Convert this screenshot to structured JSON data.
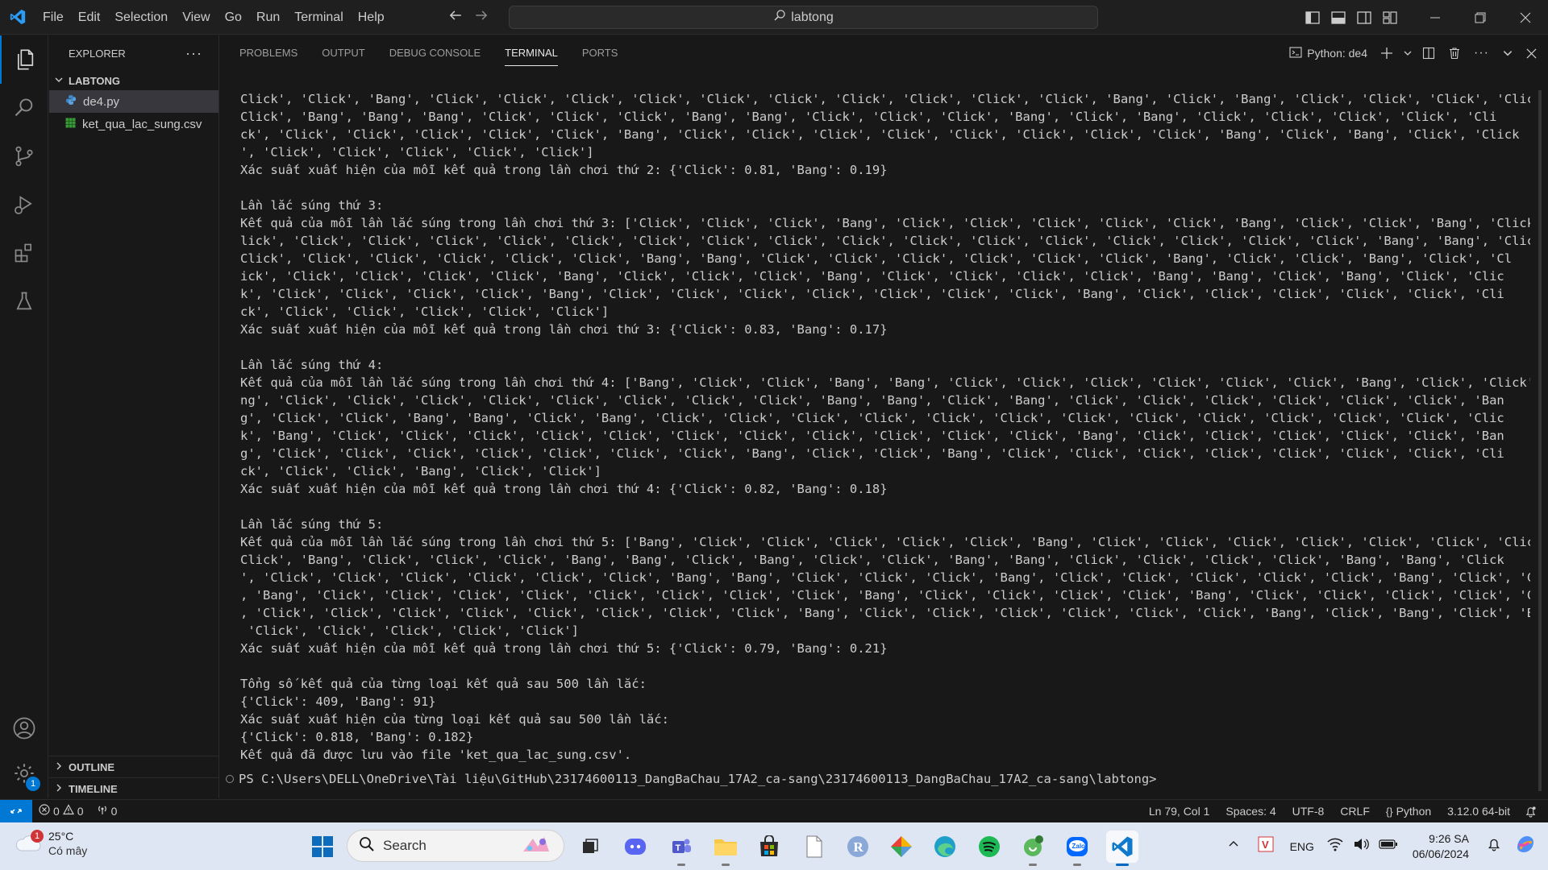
{
  "titlebar": {
    "menu": [
      "File",
      "Edit",
      "Selection",
      "View",
      "Go",
      "Run",
      "Terminal",
      "Help"
    ],
    "search_text": "labtong"
  },
  "explorer": {
    "title": "EXPLORER",
    "folder": "LABTONG",
    "files": [
      {
        "name": "de4.py",
        "icon": "python-file-icon",
        "selected": true
      },
      {
        "name": "ket_qua_lac_sung.csv",
        "icon": "csv-file-icon",
        "selected": false
      }
    ],
    "outline_label": "OUTLINE",
    "timeline_label": "TIMELINE"
  },
  "panel": {
    "tabs": [
      "PROBLEMS",
      "OUTPUT",
      "DEBUG CONSOLE",
      "TERMINAL",
      "PORTS"
    ],
    "active_tab": "TERMINAL",
    "terminal_name": "Python: de4"
  },
  "terminal": {
    "lines": [
      "Click', 'Click', 'Bang', 'Click', 'Click', 'Click', 'Click', 'Click', 'Click', 'Click', 'Click', 'Click', 'Click', 'Bang', 'Click', 'Bang', 'Click', 'Click', 'Click', 'Click', '",
      "Click', 'Bang', 'Bang', 'Bang', 'Click', 'Click', 'Click', 'Bang', 'Bang', 'Click', 'Click', 'Click', 'Bang', 'Click', 'Bang', 'Click', 'Click', 'Click', 'Click', 'Cli",
      "ck', 'Click', 'Click', 'Click', 'Click', 'Click', 'Bang', 'Click', 'Click', 'Click', 'Click', 'Click', 'Click', 'Click', 'Click', 'Bang', 'Click', 'Bang', 'Click', 'Click",
      "', 'Click', 'Click', 'Click', 'Click', 'Click']",
      "Xác suất xuất hiện của mỗi kết quả trong lần chơi thứ 2: {'Click': 0.81, 'Bang': 0.19}",
      "",
      "Lần lắc súng thứ 3:",
      "Kết quả của mỗi lần lắc súng trong lần chơi thứ 3: ['Click', 'Click', 'Click', 'Bang', 'Click', 'Click', 'Click', 'Click', 'Click', 'Bang', 'Click', 'Click', 'Bang', 'Click', 'C",
      "lick', 'Click', 'Click', 'Click', 'Click', 'Click', 'Click', 'Click', 'Click', 'Click', 'Click', 'Click', 'Click', 'Click', 'Click', 'Click', 'Click', 'Bang', 'Bang', 'Click', '",
      "Click', 'Click', 'Click', 'Click', 'Click', 'Click', 'Bang', 'Bang', 'Click', 'Click', 'Click', 'Click', 'Click', 'Click', 'Bang', 'Click', 'Click', 'Bang', 'Click', 'Cl",
      "ick', 'Click', 'Click', 'Click', 'Click', 'Bang', 'Click', 'Click', 'Click', 'Bang', 'Click', 'Click', 'Click', 'Click', 'Bang', 'Bang', 'Click', 'Bang', 'Click', 'Clic",
      "k', 'Click', 'Click', 'Click', 'Click', 'Bang', 'Click', 'Click', 'Click', 'Click', 'Click', 'Click', 'Click', 'Bang', 'Click', 'Click', 'Click', 'Click', 'Click', 'Cli",
      "ck', 'Click', 'Click', 'Click', 'Click', 'Click']",
      "Xác suất xuất hiện của mỗi kết quả trong lần chơi thứ 3: {'Click': 0.83, 'Bang': 0.17}",
      "",
      "Lần lắc súng thứ 4:",
      "Kết quả của mỗi lần lắc súng trong lần chơi thứ 4: ['Bang', 'Click', 'Click', 'Bang', 'Bang', 'Click', 'Click', 'Click', 'Click', 'Click', 'Click', 'Bang', 'Click', 'Click', 'Ba",
      "ng', 'Click', 'Click', 'Click', 'Click', 'Click', 'Click', 'Click', 'Click', 'Bang', 'Bang', 'Click', 'Bang', 'Click', 'Click', 'Click', 'Click', 'Click', 'Click', 'Ban",
      "g', 'Click', 'Click', 'Bang', 'Bang', 'Click', 'Bang', 'Click', 'Click', 'Click', 'Click', 'Click', 'Click', 'Click', 'Click', 'Click', 'Click', 'Click', 'Click', 'Clic",
      "k', 'Bang', 'Click', 'Click', 'Click', 'Click', 'Click', 'Click', 'Click', 'Click', 'Click', 'Click', 'Click', 'Bang', 'Click', 'Click', 'Click', 'Click', 'Click', 'Ban",
      "g', 'Click', 'Click', 'Click', 'Click', 'Click', 'Click', 'Click', 'Bang', 'Click', 'Click', 'Bang', 'Click', 'Click', 'Click', 'Click', 'Click', 'Click', 'Click', 'Cli",
      "ck', 'Click', 'Click', 'Bang', 'Click', 'Click']",
      "Xác suất xuất hiện của mỗi kết quả trong lần chơi thứ 4: {'Click': 0.82, 'Bang': 0.18}",
      "",
      "Lần lắc súng thứ 5:",
      "Kết quả của mỗi lần lắc súng trong lần chơi thứ 5: ['Bang', 'Click', 'Click', 'Click', 'Click', 'Click', 'Bang', 'Click', 'Click', 'Click', 'Click', 'Click', 'Click', 'Click', '",
      "Click', 'Bang', 'Click', 'Click', 'Click', 'Bang', 'Bang', 'Click', 'Bang', 'Click', 'Click', 'Bang', 'Bang', 'Click', 'Click', 'Click', 'Click', 'Bang', 'Bang', 'Click",
      "', 'Click', 'Click', 'Click', 'Click', 'Click', 'Click', 'Bang', 'Bang', 'Click', 'Click', 'Click', 'Bang', 'Click', 'Click', 'Click', 'Click', 'Click', 'Bang', 'Click', 'Click",
      ", 'Bang', 'Click', 'Click', 'Click', 'Click', 'Click', 'Click', 'Click', 'Click', 'Bang', 'Click', 'Click', 'Click', 'Click', 'Bang', 'Click', 'Click', 'Click', 'Click', 'Click",
      ", 'Click', 'Click', 'Click', 'Click', 'Click', 'Click', 'Click', 'Click', 'Bang', 'Click', 'Click', 'Click', 'Click', 'Click', 'Click', 'Bang', 'Click', 'Bang', 'Click', 'Bang',",
      " 'Click', 'Click', 'Click', 'Click', 'Click']",
      "Xác suất xuất hiện của mỗi kết quả trong lần chơi thứ 5: {'Click': 0.79, 'Bang': 0.21}",
      "",
      "Tổng số kết quả của từng loại kết quả sau 500 lần lắc:",
      "{'Click': 409, 'Bang': 91}",
      "Xác suất xuất hiện của từng loại kết quả sau 500 lần lắc:",
      "{'Click': 0.818, 'Bang': 0.182}",
      "Kết quả đã được lưu vào file 'ket_qua_lac_sung.csv'."
    ],
    "prompt": "PS C:\\Users\\DELL\\OneDrive\\Tài liệu\\GitHub\\23174600113_DangBaChau_17A2_ca-sang\\23174600113_DangBaChau_17A2_ca-sang\\labtong>"
  },
  "statusbar": {
    "errors": "0",
    "warnings": "0",
    "ports": "0",
    "position": "Ln 79, Col 1",
    "spaces": "Spaces: 4",
    "encoding": "UTF-8",
    "eol": "CRLF",
    "language": "Python",
    "interpreter": "3.12.0 64-bit"
  },
  "taskbar": {
    "weather_temp": "25°C",
    "weather_cond": "Có mây",
    "weather_badge": "1",
    "search_label": "Search",
    "lang": "ENG",
    "time": "9:26 SA",
    "date": "06/06/2024"
  },
  "colors": {
    "accent": "#0078d4",
    "editor_bg": "#181818",
    "taskbar_bg": "#dfe6f3"
  }
}
